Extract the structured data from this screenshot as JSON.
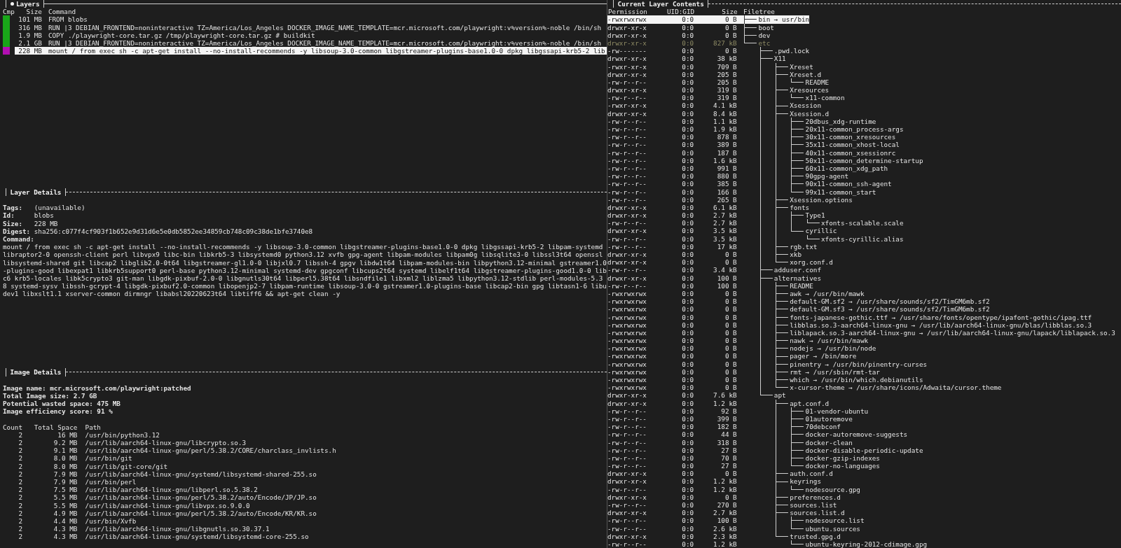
{
  "layers_panel": {
    "title": "Layers",
    "focused": true,
    "columns": [
      "Cmp",
      "Size",
      "Command"
    ],
    "rows": [
      {
        "size": "101 MB",
        "command": "FROM blobs",
        "color": "#19a619",
        "selected": false
      },
      {
        "size": "316 MB",
        "command": "RUN |3 DEBIAN_FRONTEND=noninteractive TZ=America/Los_Angeles DOCKER_IMAGE_NAME_TEMPLATE=mcr.microsoft.com/playwright:v%version%-noble /bin/sh",
        "color": "#19a619",
        "selected": false
      },
      {
        "size": "1.9 MB",
        "command": "COPY ./playwright-core.tar.gz /tmp/playwright-core.tar.gz # buildkit",
        "color": "#19a619",
        "selected": false
      },
      {
        "size": "2.1 GB",
        "command": "RUN |3 DEBIAN_FRONTEND=noninteractive TZ=America/Los_Angeles DOCKER_IMAGE_NAME_TEMPLATE=mcr.microsoft.com/playwright:v%version%-noble /bin/sh",
        "color": "#19a619",
        "selected": false
      },
      {
        "size": "228 MB",
        "command": "mount / from exec sh -c apt-get install --no-install-recommends -y libsoup-3.0-common libgstreamer-plugins-base1.0-0 dpkg libgssapi-krb5-2 lib",
        "color": "#b30fb3",
        "selected": true
      }
    ]
  },
  "layer_details": {
    "title": "Layer Details",
    "fields": [
      {
        "label": "Tags:",
        "value": "(unavailable)"
      },
      {
        "label": "Id:",
        "value": "blobs"
      },
      {
        "label": "Size:",
        "value": "228 MB"
      },
      {
        "label": "Digest:",
        "value": "sha256:c077f4cf903f1b652e9d31d6e5e0db5852ee34859cb748c09c38de1bfe3740e8"
      }
    ],
    "command_label": "Command:",
    "command": "mount / from exec sh -c apt-get install --no-install-recommends -y libsoup-3.0-common libgstreamer-plugins-base1.0-0 dpkg libgssapi-krb5-2 libpam-systemd libraptor2-0 openssh-client perl libvpx9 libc-bin libkrb5-3 libsystemd0 python3.12 xvfb gpg-agent libpam-modules libpam0g libsqlite3-0 libssl3t64 openssl libsystemd-shared git libcap2 libglib2.0-0t64 libgstreamer-gl1.0-0 libjxl0.7 libssh-4 gpgv libdw1t64 libpam-modules-bin libpython3.12-minimal gstreamer1.0-plugins-good libexpat1 libkrb5support0 perl-base python3.12-minimal systemd-dev gpgconf libcups2t64 systemd libelf1t64 libgstreamer-plugins-good1.0-0 libc6 krb5-locales libk5crypto3 git-man libgdk-pixbuf-2.0-0 libgnutls30t64 libperl5.38t64 libsndfile1 libxml2 liblzma5 libpython3.12-stdlib perl-modules-5.38 systemd-sysv libssh-gcrypt-4 libgdk-pixbuf2.0-common libopenjp2-7 libpam-runtime libsoup-3.0-0 gstreamer1.0-plugins-base libcap2-bin gpg libtasn1-6 libudev1 libxslt1.1 xserver-common dirmngr libabsl20220623t64 libtiff6 && apt-get clean -y"
  },
  "image_details": {
    "title": "Image Details",
    "fields": [
      {
        "label": "Image name:",
        "value": "mcr.microsoft.com/playwright:patched"
      },
      {
        "label": "Total Image size:",
        "value": "2.7 GB"
      },
      {
        "label": "Potential wasted space:",
        "value": "475 MB"
      },
      {
        "label": "Image efficiency score:",
        "value": "91 %"
      }
    ],
    "columns": [
      "Count",
      "Total Space",
      "Path"
    ],
    "rows": [
      {
        "count": "2",
        "total_space": "16 MB",
        "path": "/usr/bin/python3.12"
      },
      {
        "count": "2",
        "total_space": "9.2 MB",
        "path": "/usr/lib/aarch64-linux-gnu/libcrypto.so.3"
      },
      {
        "count": "2",
        "total_space": "9.1 MB",
        "path": "/usr/lib/aarch64-linux-gnu/perl/5.38.2/CORE/charclass_invlists.h"
      },
      {
        "count": "2",
        "total_space": "8.0 MB",
        "path": "/usr/bin/git"
      },
      {
        "count": "2",
        "total_space": "8.0 MB",
        "path": "/usr/lib/git-core/git"
      },
      {
        "count": "2",
        "total_space": "7.9 MB",
        "path": "/usr/lib/aarch64-linux-gnu/systemd/libsystemd-shared-255.so"
      },
      {
        "count": "2",
        "total_space": "7.9 MB",
        "path": "/usr/bin/perl"
      },
      {
        "count": "2",
        "total_space": "7.5 MB",
        "path": "/usr/lib/aarch64-linux-gnu/libperl.so.5.38.2"
      },
      {
        "count": "2",
        "total_space": "5.5 MB",
        "path": "/usr/lib/aarch64-linux-gnu/perl/5.38.2/auto/Encode/JP/JP.so"
      },
      {
        "count": "2",
        "total_space": "5.5 MB",
        "path": "/usr/lib/aarch64-linux-gnu/libvpx.so.9.0.0"
      },
      {
        "count": "2",
        "total_space": "4.9 MB",
        "path": "/usr/lib/aarch64-linux-gnu/perl/5.38.2/auto/Encode/KR/KR.so"
      },
      {
        "count": "2",
        "total_space": "4.4 MB",
        "path": "/usr/bin/Xvfb"
      },
      {
        "count": "2",
        "total_space": "4.3 MB",
        "path": "/usr/lib/aarch64-linux-gnu/libgnutls.so.30.37.1"
      },
      {
        "count": "2",
        "total_space": "4.3 MB",
        "path": "/usr/lib/aarch64-linux-gnu/systemd/libsystemd-core-255.so"
      }
    ]
  },
  "layer_contents": {
    "title": "Current Layer Contents",
    "columns": [
      "Permission",
      "UID:GID",
      "Size",
      "Filetree"
    ],
    "tree": [
      {
        "name": "bin → usr/bin",
        "permission": "-rwxrwxrwx",
        "uid_gid": "0:0",
        "size": "0 B",
        "selected": true,
        "modified": false
      },
      {
        "name": "boot",
        "permission": "drwxr-xr-x",
        "uid_gid": "0:0",
        "size": "0 B",
        "selected": false,
        "modified": false
      },
      {
        "name": "dev",
        "permission": "drwxr-xr-x",
        "uid_gid": "0:0",
        "size": "0 B",
        "selected": false,
        "modified": false
      },
      {
        "name": "etc",
        "permission": "drwxr-xr-x",
        "uid_gid": "0:0",
        "size": "827 kB",
        "selected": false,
        "modified": true,
        "children": [
          {
            "name": ".pwd.lock",
            "permission": "-rw-------",
            "uid_gid": "0:0",
            "size": "0 B",
            "selected": false,
            "modified": false
          },
          {
            "name": "X11",
            "permission": "drwxr-xr-x",
            "uid_gid": "0:0",
            "size": "38 kB",
            "selected": false,
            "modified": false,
            "children": [
              {
                "name": "Xreset",
                "permission": "-rwxr-xr-x",
                "uid_gid": "0:0",
                "size": "709 B",
                "selected": false,
                "modified": false
              },
              {
                "name": "Xreset.d",
                "permission": "drwxr-xr-x",
                "uid_gid": "0:0",
                "size": "205 B",
                "selected": false,
                "modified": false,
                "children": [
                  {
                    "name": "README",
                    "permission": "-rw-r--r--",
                    "uid_gid": "0:0",
                    "size": "205 B",
                    "selected": false,
                    "modified": false
                  }
                ]
              },
              {
                "name": "Xresources",
                "permission": "drwxr-xr-x",
                "uid_gid": "0:0",
                "size": "319 B",
                "selected": false,
                "modified": false,
                "children": [
                  {
                    "name": "x11-common",
                    "permission": "-rw-r--r--",
                    "uid_gid": "0:0",
                    "size": "319 B",
                    "selected": false,
                    "modified": false
                  }
                ]
              },
              {
                "name": "Xsession",
                "permission": "-rwxr-xr-x",
                "uid_gid": "0:0",
                "size": "4.1 kB",
                "selected": false,
                "modified": false
              },
              {
                "name": "Xsession.d",
                "permission": "drwxr-xr-x",
                "uid_gid": "0:0",
                "size": "8.4 kB",
                "selected": false,
                "modified": false,
                "children": [
                  {
                    "name": "20dbus_xdg-runtime",
                    "permission": "-rw-r--r--",
                    "uid_gid": "0:0",
                    "size": "1.1 kB",
                    "selected": false,
                    "modified": false
                  },
                  {
                    "name": "20x11-common_process-args",
                    "permission": "-rw-r--r--",
                    "uid_gid": "0:0",
                    "size": "1.9 kB",
                    "selected": false,
                    "modified": false
                  },
                  {
                    "name": "30x11-common_xresources",
                    "permission": "-rw-r--r--",
                    "uid_gid": "0:0",
                    "size": "878 B",
                    "selected": false,
                    "modified": false
                  },
                  {
                    "name": "35x11-common_xhost-local",
                    "permission": "-rw-r--r--",
                    "uid_gid": "0:0",
                    "size": "389 B",
                    "selected": false,
                    "modified": false
                  },
                  {
                    "name": "40x11-common_xsessionrc",
                    "permission": "-rw-r--r--",
                    "uid_gid": "0:0",
                    "size": "187 B",
                    "selected": false,
                    "modified": false
                  },
                  {
                    "name": "50x11-common_determine-startup",
                    "permission": "-rw-r--r--",
                    "uid_gid": "0:0",
                    "size": "1.6 kB",
                    "selected": false,
                    "modified": false
                  },
                  {
                    "name": "60x11-common_xdg_path",
                    "permission": "-rw-r--r--",
                    "uid_gid": "0:0",
                    "size": "991 B",
                    "selected": false,
                    "modified": false
                  },
                  {
                    "name": "90gpg-agent",
                    "permission": "-rw-r--r--",
                    "uid_gid": "0:0",
                    "size": "880 B",
                    "selected": false,
                    "modified": false
                  },
                  {
                    "name": "90x11-common_ssh-agent",
                    "permission": "-rw-r--r--",
                    "uid_gid": "0:0",
                    "size": "385 B",
                    "selected": false,
                    "modified": false
                  },
                  {
                    "name": "99x11-common_start",
                    "permission": "-rw-r--r--",
                    "uid_gid": "0:0",
                    "size": "166 B",
                    "selected": false,
                    "modified": false
                  }
                ]
              },
              {
                "name": "Xsession.options",
                "permission": "-rw-r--r--",
                "uid_gid": "0:0",
                "size": "265 B",
                "selected": false,
                "modified": false
              },
              {
                "name": "fonts",
                "permission": "drwxr-xr-x",
                "uid_gid": "0:0",
                "size": "6.1 kB",
                "selected": false,
                "modified": false,
                "children": [
                  {
                    "name": "Type1",
                    "permission": "drwxr-xr-x",
                    "uid_gid": "0:0",
                    "size": "2.7 kB",
                    "selected": false,
                    "modified": false,
                    "children": [
                      {
                        "name": "xfonts-scalable.scale",
                        "permission": "-rw-r--r--",
                        "uid_gid": "0:0",
                        "size": "2.7 kB",
                        "selected": false,
                        "modified": false
                      }
                    ]
                  },
                  {
                    "name": "cyrillic",
                    "permission": "drwxr-xr-x",
                    "uid_gid": "0:0",
                    "size": "3.5 kB",
                    "selected": false,
                    "modified": false,
                    "children": [
                      {
                        "name": "xfonts-cyrillic.alias",
                        "permission": "-rw-r--r--",
                        "uid_gid": "0:0",
                        "size": "3.5 kB",
                        "selected": false,
                        "modified": false
                      }
                    ]
                  }
                ]
              },
              {
                "name": "rgb.txt",
                "permission": "-rw-r--r--",
                "uid_gid": "0:0",
                "size": "17 kB",
                "selected": false,
                "modified": false
              },
              {
                "name": "xkb",
                "permission": "drwxr-xr-x",
                "uid_gid": "0:0",
                "size": "0 B",
                "selected": false,
                "modified": false
              },
              {
                "name": "xorg.conf.d",
                "permission": "drwxr-xr-x",
                "uid_gid": "0:0",
                "size": "0 B",
                "selected": false,
                "modified": false
              }
            ]
          },
          {
            "name": "adduser.conf",
            "permission": "-rw-r--r--",
            "uid_gid": "0:0",
            "size": "3.4 kB",
            "selected": false,
            "modified": false
          },
          {
            "name": "alternatives",
            "permission": "drwxr-xr-x",
            "uid_gid": "0:0",
            "size": "100 B",
            "selected": false,
            "modified": false,
            "children": [
              {
                "name": "README",
                "permission": "-rw-r--r--",
                "uid_gid": "0:0",
                "size": "100 B",
                "selected": false,
                "modified": false
              },
              {
                "name": "awk → /usr/bin/mawk",
                "permission": "-rwxrwxrwx",
                "uid_gid": "0:0",
                "size": "0 B",
                "selected": false,
                "modified": false
              },
              {
                "name": "default-GM.sf2 → /usr/share/sounds/sf2/TimGM6mb.sf2",
                "permission": "-rwxrwxrwx",
                "uid_gid": "0:0",
                "size": "0 B",
                "selected": false,
                "modified": false
              },
              {
                "name": "default-GM.sf3 → /usr/share/sounds/sf2/TimGM6mb.sf2",
                "permission": "-rwxrwxrwx",
                "uid_gid": "0:0",
                "size": "0 B",
                "selected": false,
                "modified": false
              },
              {
                "name": "fonts-japanese-gothic.ttf → /usr/share/fonts/opentype/ipafont-gothic/ipag.ttf",
                "permission": "-rwxrwxrwx",
                "uid_gid": "0:0",
                "size": "0 B",
                "selected": false,
                "modified": false
              },
              {
                "name": "libblas.so.3-aarch64-linux-gnu → /usr/lib/aarch64-linux-gnu/blas/libblas.so.3",
                "permission": "-rwxrwxrwx",
                "uid_gid": "0:0",
                "size": "0 B",
                "selected": false,
                "modified": false
              },
              {
                "name": "liblapack.so.3-aarch64-linux-gnu → /usr/lib/aarch64-linux-gnu/lapack/liblapack.so.3",
                "permission": "-rwxrwxrwx",
                "uid_gid": "0:0",
                "size": "0 B",
                "selected": false,
                "modified": false
              },
              {
                "name": "nawk → /usr/bin/mawk",
                "permission": "-rwxrwxrwx",
                "uid_gid": "0:0",
                "size": "0 B",
                "selected": false,
                "modified": false
              },
              {
                "name": "nodejs → /usr/bin/node",
                "permission": "-rwxrwxrwx",
                "uid_gid": "0:0",
                "size": "0 B",
                "selected": false,
                "modified": false
              },
              {
                "name": "pager → /bin/more",
                "permission": "-rwxrwxrwx",
                "uid_gid": "0:0",
                "size": "0 B",
                "selected": false,
                "modified": false
              },
              {
                "name": "pinentry → /usr/bin/pinentry-curses",
                "permission": "-rwxrwxrwx",
                "uid_gid": "0:0",
                "size": "0 B",
                "selected": false,
                "modified": false
              },
              {
                "name": "rmt → /usr/sbin/rmt-tar",
                "permission": "-rwxrwxrwx",
                "uid_gid": "0:0",
                "size": "0 B",
                "selected": false,
                "modified": false
              },
              {
                "name": "which → /usr/bin/which.debianutils",
                "permission": "-rwxrwxrwx",
                "uid_gid": "0:0",
                "size": "0 B",
                "selected": false,
                "modified": false
              },
              {
                "name": "x-cursor-theme → /usr/share/icons/Adwaita/cursor.theme",
                "permission": "-rwxrwxrwx",
                "uid_gid": "0:0",
                "size": "0 B",
                "selected": false,
                "modified": false
              }
            ]
          },
          {
            "name": "apt",
            "permission": "drwxr-xr-x",
            "uid_gid": "0:0",
            "size": "7.6 kB",
            "selected": false,
            "modified": false,
            "children": [
              {
                "name": "apt.conf.d",
                "permission": "drwxr-xr-x",
                "uid_gid": "0:0",
                "size": "1.2 kB",
                "selected": false,
                "modified": false,
                "children": [
                  {
                    "name": "01-vendor-ubuntu",
                    "permission": "-rw-r--r--",
                    "uid_gid": "0:0",
                    "size": "92 B",
                    "selected": false,
                    "modified": false
                  },
                  {
                    "name": "01autoremove",
                    "permission": "-rw-r--r--",
                    "uid_gid": "0:0",
                    "size": "399 B",
                    "selected": false,
                    "modified": false
                  },
                  {
                    "name": "70debconf",
                    "permission": "-rw-r--r--",
                    "uid_gid": "0:0",
                    "size": "182 B",
                    "selected": false,
                    "modified": false
                  },
                  {
                    "name": "docker-autoremove-suggests",
                    "permission": "-rw-r--r--",
                    "uid_gid": "0:0",
                    "size": "44 B",
                    "selected": false,
                    "modified": false
                  },
                  {
                    "name": "docker-clean",
                    "permission": "-rw-r--r--",
                    "uid_gid": "0:0",
                    "size": "318 B",
                    "selected": false,
                    "modified": false
                  },
                  {
                    "name": "docker-disable-periodic-update",
                    "permission": "-rw-r--r--",
                    "uid_gid": "0:0",
                    "size": "27 B",
                    "selected": false,
                    "modified": false
                  },
                  {
                    "name": "docker-gzip-indexes",
                    "permission": "-rw-r--r--",
                    "uid_gid": "0:0",
                    "size": "70 B",
                    "selected": false,
                    "modified": false
                  },
                  {
                    "name": "docker-no-languages",
                    "permission": "-rw-r--r--",
                    "uid_gid": "0:0",
                    "size": "27 B",
                    "selected": false,
                    "modified": false
                  }
                ]
              },
              {
                "name": "auth.conf.d",
                "permission": "drwxr-xr-x",
                "uid_gid": "0:0",
                "size": "0 B",
                "selected": false,
                "modified": false
              },
              {
                "name": "keyrings",
                "permission": "drwxr-xr-x",
                "uid_gid": "0:0",
                "size": "1.2 kB",
                "selected": false,
                "modified": false,
                "children": [
                  {
                    "name": "nodesource.gpg",
                    "permission": "-rw-r--r--",
                    "uid_gid": "0:0",
                    "size": "1.2 kB",
                    "selected": false,
                    "modified": false
                  }
                ]
              },
              {
                "name": "preferences.d",
                "permission": "drwxr-xr-x",
                "uid_gid": "0:0",
                "size": "0 B",
                "selected": false,
                "modified": false
              },
              {
                "name": "sources.list",
                "permission": "-rw-r--r--",
                "uid_gid": "0:0",
                "size": "270 B",
                "selected": false,
                "modified": false
              },
              {
                "name": "sources.list.d",
                "permission": "drwxr-xr-x",
                "uid_gid": "0:0",
                "size": "2.7 kB",
                "selected": false,
                "modified": false,
                "children": [
                  {
                    "name": "nodesource.list",
                    "permission": "-rw-r--r--",
                    "uid_gid": "0:0",
                    "size": "100 B",
                    "selected": false,
                    "modified": false
                  },
                  {
                    "name": "ubuntu.sources",
                    "permission": "-rw-r--r--",
                    "uid_gid": "0:0",
                    "size": "2.6 kB",
                    "selected": false,
                    "modified": false
                  }
                ]
              },
              {
                "name": "trusted.gpg.d",
                "permission": "drwxr-xr-x",
                "uid_gid": "0:0",
                "size": "2.3 kB",
                "selected": false,
                "modified": false,
                "children": [
                  {
                    "name": "ubuntu-keyring-2012-cdimage.gpg",
                    "permission": "-rw-r--r--",
                    "uid_gid": "0:0",
                    "size": "1.2 kB",
                    "selected": false,
                    "modified": false
                  }
                ]
              }
            ]
          }
        ]
      }
    ]
  }
}
